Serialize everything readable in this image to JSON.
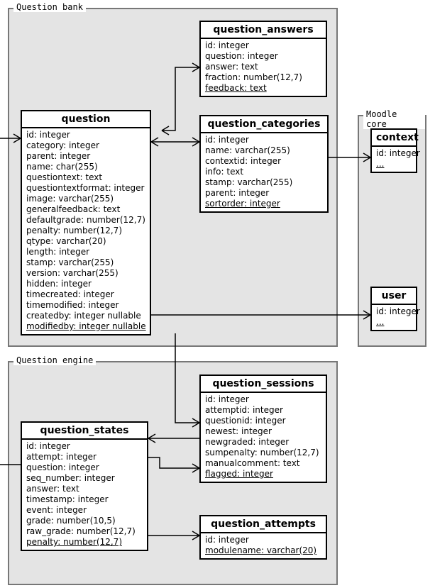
{
  "groups": {
    "bank": {
      "label": "Question bank"
    },
    "core": {
      "label": "Moodle core"
    },
    "engine": {
      "label": "Question engine"
    }
  },
  "entities": {
    "question": {
      "name": "question",
      "fields": [
        "id: integer",
        "category: integer",
        "parent: integer",
        "name: char(255)",
        "questiontext: text",
        "questiontextformat: integer",
        "image: varchar(255)",
        "generalfeedback: text",
        "defaultgrade: number(12,7)",
        "penalty: number(12,7)",
        "qtype: varchar(20)",
        "length: integer",
        "stamp: varchar(255)",
        "version: varchar(255)",
        "hidden: integer",
        "timecreated: integer",
        "timemodified: integer",
        "createdby: integer nullable",
        "modifiedby: integer nullable"
      ]
    },
    "question_answers": {
      "name": "question_answers",
      "fields": [
        "id: integer",
        "question: integer",
        "answer: text",
        "fraction: number(12,7)",
        "feedback: text"
      ]
    },
    "question_categories": {
      "name": "question_categories",
      "fields": [
        "id: integer",
        "name: varchar(255)",
        "contextid: integer",
        "info: text",
        "stamp: varchar(255)",
        "parent: integer",
        "sortorder: integer"
      ]
    },
    "context": {
      "name": "context",
      "fields": [
        "id: integer",
        "..."
      ]
    },
    "user": {
      "name": "user",
      "fields": [
        "id: integer",
        "..."
      ]
    },
    "question_states": {
      "name": "question_states",
      "fields": [
        "id: integer",
        "attempt: integer",
        "question: integer",
        "seq_number: integer",
        "answer: text",
        "timestamp: integer",
        "event: integer",
        "grade: number(10,5)",
        "raw_grade: number(12,7)",
        "penalty: number(12,7)"
      ]
    },
    "question_sessions": {
      "name": "question_sessions",
      "fields": [
        "id: integer",
        "attemptid: integer",
        "questionid: integer",
        "newest: integer",
        "newgraded: integer",
        "sumpenalty: number(12,7)",
        "manualcomment: text",
        "flagged: integer"
      ]
    },
    "question_attempts": {
      "name": "question_attempts",
      "fields": [
        "id: integer",
        "modulename: varchar(20)"
      ]
    }
  }
}
